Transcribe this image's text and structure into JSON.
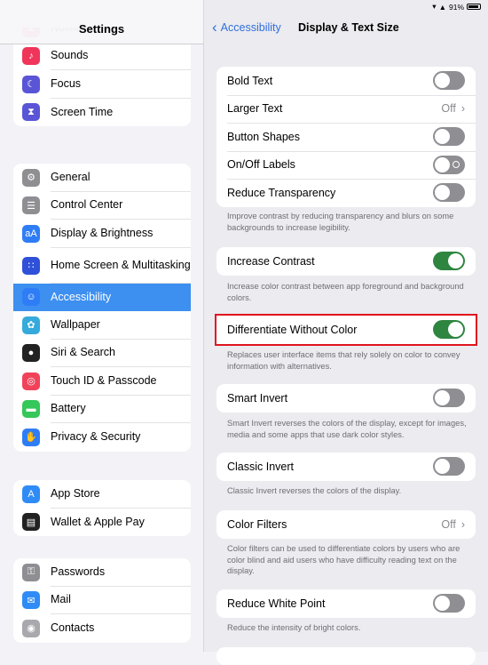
{
  "sidebar": {
    "title": "Settings",
    "groups": [
      [
        {
          "label": "Notifications",
          "icon": "bell-icon",
          "color": "#f0433a"
        },
        {
          "label": "Sounds",
          "icon": "speaker-icon",
          "color": "#f0345a"
        },
        {
          "label": "Focus",
          "icon": "moon-icon",
          "color": "#5a55d6"
        },
        {
          "label": "Screen Time",
          "icon": "hourglass-icon",
          "color": "#5a55d6"
        }
      ],
      [
        {
          "label": "General",
          "icon": "gear-icon",
          "color": "#8e8e93"
        },
        {
          "label": "Control Center",
          "icon": "toggles-icon",
          "color": "#8e8e93"
        },
        {
          "label": "Display & Brightness",
          "icon": "text-size-icon",
          "color": "#2f7df6"
        },
        {
          "label": "Home Screen & Multitasking",
          "icon": "grid-icon",
          "color": "#2f50d8"
        },
        {
          "label": "Accessibility",
          "icon": "accessibility-icon",
          "color": "#2f7df6"
        },
        {
          "label": "Wallpaper",
          "icon": "flower-icon",
          "color": "#35aadc"
        },
        {
          "label": "Siri & Search",
          "icon": "siri-icon",
          "color": "#222"
        },
        {
          "label": "Touch ID & Passcode",
          "icon": "fingerprint-icon",
          "color": "#f0435a"
        },
        {
          "label": "Battery",
          "icon": "battery-icon",
          "color": "#34c759"
        },
        {
          "label": "Privacy & Security",
          "icon": "hand-icon",
          "color": "#2f7df6"
        }
      ],
      [
        {
          "label": "App Store",
          "icon": "app-store-icon",
          "color": "#2f8cf6"
        },
        {
          "label": "Wallet & Apple Pay",
          "icon": "wallet-icon",
          "color": "#222"
        }
      ],
      [
        {
          "label": "Passwords",
          "icon": "key-icon",
          "color": "#8e8e93"
        },
        {
          "label": "Mail",
          "icon": "mail-icon",
          "color": "#2f8cf6"
        },
        {
          "label": "Contacts",
          "icon": "contacts-icon",
          "color": "#a8a8ad"
        }
      ]
    ],
    "selected": "Accessibility"
  },
  "status": {
    "battery": "91%",
    "battery_level": 0.91
  },
  "nav": {
    "back": "Accessibility",
    "title": "Display & Text Size"
  },
  "main": {
    "group1": [
      {
        "label": "Bold Text",
        "toggle": false
      },
      {
        "label": "Larger Text",
        "value": "Off"
      },
      {
        "label": "Button Shapes",
        "toggle": false
      },
      {
        "label": "On/Off Labels",
        "toggle": false
      },
      {
        "label": "Reduce Transparency",
        "toggle": false
      }
    ],
    "footer1": "Improve contrast by reducing transparency and blurs on some backgrounds to increase legibility.",
    "increase_contrast": {
      "label": "Increase Contrast",
      "toggle": true
    },
    "footer2": "Increase color contrast between app foreground and background colors.",
    "differentiate": {
      "label": "Differentiate Without Color",
      "toggle": true
    },
    "footer3": "Replaces user interface items that rely solely on color to convey information with alternatives.",
    "smart_invert": {
      "label": "Smart Invert",
      "toggle": false
    },
    "footer4": "Smart Invert reverses the colors of the display, except for images, media and some apps that use dark color styles.",
    "classic_invert": {
      "label": "Classic Invert",
      "toggle": false
    },
    "footer5": "Classic Invert reverses the colors of the display.",
    "color_filters": {
      "label": "Color Filters",
      "value": "Off"
    },
    "footer6": "Color filters can be used to differentiate colors by users who are color blind and aid users who have difficulty reading text on the display.",
    "reduce_white": {
      "label": "Reduce White Point",
      "toggle": false
    },
    "footer7": "Reduce the intensity of bright colors."
  },
  "colors": {
    "accent": "#2f6fdb",
    "toggle_on": "#2e8540",
    "highlight": "#e0141e",
    "selected": "#3d8ff0"
  }
}
